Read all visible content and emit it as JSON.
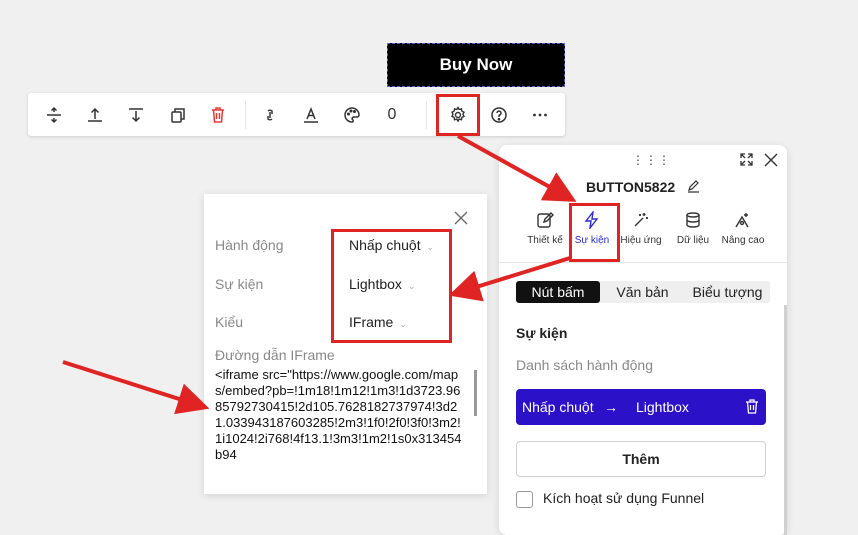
{
  "buy_button": {
    "label": "Buy Now"
  },
  "toolbar": {
    "icons": [
      "spacing-icon",
      "align-top-icon",
      "align-bottom-icon",
      "duplicate-icon",
      "delete-icon",
      "link-icon",
      "text-style-icon",
      "palette-icon",
      "gear-icon",
      "help-icon",
      "more-icon"
    ],
    "count": "0"
  },
  "panel": {
    "title": "BUTTON5822",
    "tabs": [
      {
        "label": "Thiết kế",
        "icon": "edit-icon"
      },
      {
        "label": "Sự kiện",
        "icon": "lightning-icon"
      },
      {
        "label": "Hiệu ứng",
        "icon": "magic-wand-icon"
      },
      {
        "label": "Dữ liệu",
        "icon": "database-icon"
      },
      {
        "label": "Nâng cao",
        "icon": "advanced-icon"
      }
    ],
    "segments": [
      "Nút bấm",
      "Văn bản",
      "Biểu tượng"
    ],
    "section_title": "Sự kiện",
    "list_label": "Danh sách hành động",
    "action": {
      "trigger": "Nhấp chuột",
      "arrow": "→",
      "type": "Lightbox"
    },
    "add_label": "Thêm",
    "funnel_label": "Kích hoạt sử dụng Funnel"
  },
  "popup": {
    "fields": [
      {
        "label": "Hành động",
        "value": "Nhấp chuột"
      },
      {
        "label": "Sự kiện",
        "value": "Lightbox"
      },
      {
        "label": "Kiểu",
        "value": "IFrame"
      }
    ],
    "iframe_label": "Đường dẫn IFrame",
    "iframe_code": "<iframe src=\"https://www.google.com/maps/embed?pb=!1m18!1m12!1m3!1d3723.9685792730415!2d105.7628182737974!3d21.033943187603285!2m3!1f0!2f0!3f0!3m2!1i1024!2i768!4f13.1!3m3!1m2!1s0x313454b94"
  },
  "colors": {
    "highlight": "#e02424",
    "accent": "#2b12c9"
  }
}
